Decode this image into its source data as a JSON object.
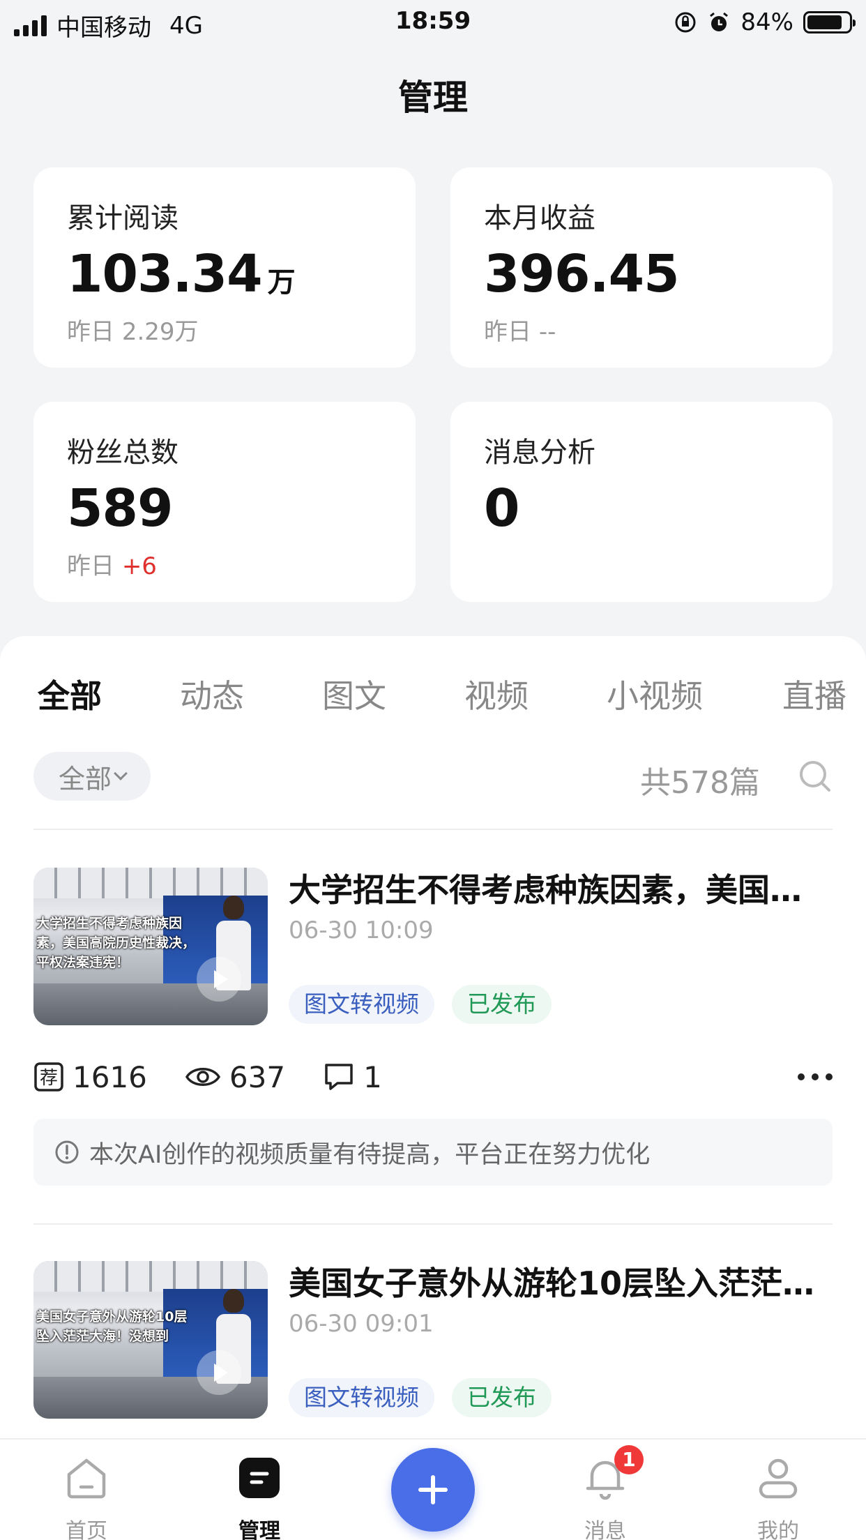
{
  "status_bar": {
    "carrier": "中国移动",
    "network": "4G",
    "time": "18:59",
    "battery": "84%",
    "battery_level": 0.84
  },
  "page_title": "管理",
  "stats": {
    "total_reads": {
      "label": "累计阅读",
      "value": "103.34",
      "unit": "万",
      "sub_label": "昨日",
      "sub_value": "2.29万"
    },
    "monthly_income": {
      "label": "本月收益",
      "value": "396.45",
      "sub_label": "昨日",
      "sub_value": "--"
    },
    "followers": {
      "label": "粉丝总数",
      "value": "589",
      "sub_label": "昨日",
      "sub_value": "+6"
    },
    "message_analysis": {
      "label": "消息分析",
      "value": "0"
    }
  },
  "tabs": [
    "全部",
    "动态",
    "图文",
    "视频",
    "小视频",
    "直播"
  ],
  "active_tab": "全部",
  "filter": {
    "label": "全部",
    "count_text": "共578篇"
  },
  "posts": [
    {
      "title": "大学招生不得考虑种族因素，美国高院历史性裁决，平权法案违宪！",
      "thumb_caption": "大学招生不得考虑种族因素，美国高院历史性裁决，平权法案违宪！",
      "date": "06-30 10:09",
      "tags": [
        "图文转视频",
        "已发布"
      ],
      "recommend": "1616",
      "views": "637",
      "comments": "1",
      "notice": "本次AI创作的视频质量有待提高，平台正在努力优化"
    },
    {
      "title": "美国女子意外从游轮10层坠入茫茫大海！没想到",
      "thumb_caption": "美国女子意外从游轮10层坠入茫茫大海！没想到",
      "date": "06-30 09:01",
      "tags": [
        "图文转视频",
        "已发布"
      ]
    }
  ],
  "bottom_nav": {
    "home": "首页",
    "manage": "管理",
    "messages": "消息",
    "messages_badge": "1",
    "mine": "我的"
  },
  "colors": {
    "accent": "#4a6ee8",
    "positive_red": "#e0302d",
    "tag_blue": "#3a5fbf",
    "tag_green": "#1f9955"
  }
}
